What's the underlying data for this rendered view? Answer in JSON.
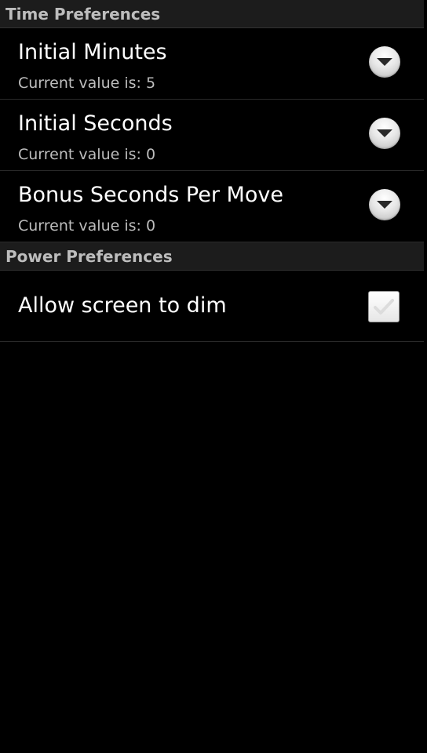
{
  "sections": [
    {
      "header": "Time Preferences",
      "items": [
        {
          "title": "Initial Minutes",
          "summary": "Current value is: 5"
        },
        {
          "title": "Initial Seconds",
          "summary": "Current value is: 0"
        },
        {
          "title": "Bonus Seconds Per Move",
          "summary": "Current value is: 0"
        }
      ]
    },
    {
      "header": "Power Preferences",
      "items": [
        {
          "title": "Allow screen to dim",
          "checked": false
        }
      ]
    }
  ],
  "icons": {
    "dropdown": "chevron-down-icon",
    "checkbox": "checkbox-icon"
  }
}
